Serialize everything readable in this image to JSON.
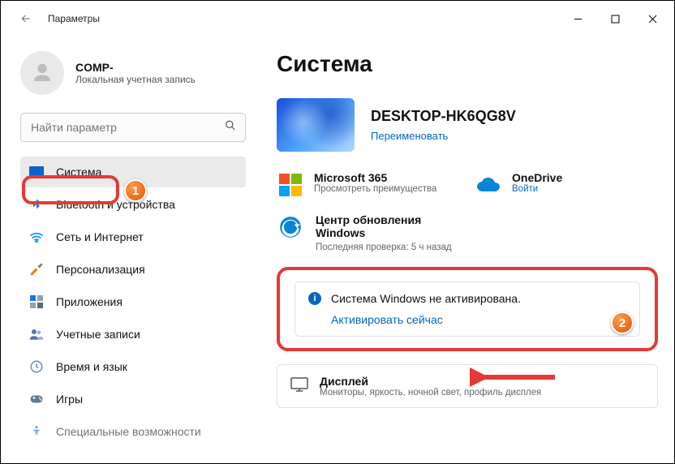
{
  "app_title": "Параметры",
  "user": {
    "name": "COMP-",
    "sub": "Локальная учетная запись"
  },
  "search": {
    "placeholder": "Найти параметр"
  },
  "nav": [
    {
      "label": "Система"
    },
    {
      "label": "Bluetooth и устройства"
    },
    {
      "label": "Сеть и Интернет"
    },
    {
      "label": "Персонализация"
    },
    {
      "label": "Приложения"
    },
    {
      "label": "Учетные записи"
    },
    {
      "label": "Время и язык"
    },
    {
      "label": "Игры"
    },
    {
      "label": "Специальные возможности"
    }
  ],
  "page_title": "Система",
  "pc": {
    "name": "DESKTOP-HK6QG8V",
    "rename": "Переименовать"
  },
  "m365": {
    "title": "Microsoft 365",
    "sub": "Просмотреть преимущества"
  },
  "onedrive": {
    "title": "OneDrive",
    "sub": "Войти"
  },
  "update": {
    "title": "Центр обновления Windows",
    "sub": "Последняя проверка: 5 ч назад"
  },
  "activation": {
    "text": "Система Windows не активирована.",
    "link": "Активировать сейчас"
  },
  "display": {
    "title": "Дисплей",
    "sub": "Мониторы, яркость, ночной свет, профиль дисплея"
  },
  "annotations": {
    "b1": "1",
    "b2": "2"
  }
}
